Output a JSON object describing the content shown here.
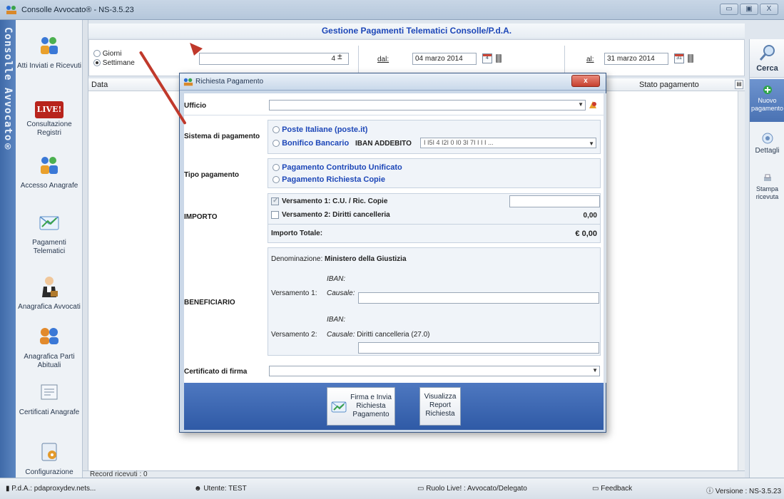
{
  "window": {
    "title": "Consolle Avvocato® - NS-3.5.23",
    "buttons": [
      "▭",
      "▣",
      "X"
    ]
  },
  "left_strip": {
    "text": "Consolle Avvocato®"
  },
  "nav": [
    {
      "label": "Atti Inviati e Ricevuti",
      "icon": "people-icon"
    },
    {
      "label": "Consultazione Registri",
      "icon": "live-icon",
      "badge": "LIVE!"
    },
    {
      "label": "Accesso Anagrafe",
      "icon": "people-icon"
    },
    {
      "label": "Pagamenti Telematici",
      "icon": "envelope-icon"
    },
    {
      "label": "Anagrafica Avvocati",
      "icon": "lawyer-icon"
    },
    {
      "label": "Anagrafica Parti Abituali",
      "icon": "people-pair-icon"
    },
    {
      "label": "Certificati Anagrafe",
      "icon": "certificate-icon"
    },
    {
      "label": "Configurazione",
      "icon": "config-icon"
    }
  ],
  "header": {
    "title": "Gestione Pagamenti Telematici Consolle/P.d.A."
  },
  "filter": {
    "radio_giorni": "Giorni",
    "radio_settimane": "Settimane",
    "number_value": "4",
    "dal_label": "dal:",
    "dal_value": "04 marzo 2014",
    "al_label": "al:",
    "al_value": "31 marzo 2014",
    "cal1": "4",
    "cal2": "31"
  },
  "table": {
    "col_data": "Data",
    "col_stato": "Stato pagamento",
    "record_count": "Record ricevuti : 0"
  },
  "right_bar": {
    "cerca": "Cerca",
    "nuovo": "Nuovo pagamento",
    "dettagli": "Dettagli",
    "stampa": "Stampa ricevuta"
  },
  "status": {
    "pda": "P.d.A.: pdaproxydev.nets...",
    "utente": "Utente: TEST",
    "ruolo": "Ruolo Live! : Avvocato/Delegato",
    "feedback": "Feedback",
    "versione": "Versione : NS-3.5.23"
  },
  "dialog": {
    "title": "Richiesta Pagamento",
    "close": "x",
    "ufficio_label": "Ufficio",
    "sistema_label": "Sistema di pagamento",
    "sistema_opt1": "Poste Italiane (poste.it)",
    "sistema_opt2": "Bonifico Bancario",
    "iban_addebito_label": "IBAN ADDEBITO",
    "iban_addebito_value": "I  I5I   4  I2I   0  I0   3I  7I  I  I  I ...",
    "tipo_label": "Tipo pagamento",
    "tipo_opt1": "Pagamento Contributo Unificato",
    "tipo_opt2": "Pagamento Richiesta Copie",
    "importo_label": "IMPORTO",
    "versamento1": "Versamento 1:  C.U. / Ric. Copie",
    "versamento2": "Versamento 2:  Diritti cancelleria",
    "versamento2_value": "0,00",
    "importo_totale_label": "Importo Totale:",
    "importo_totale_value": "€ 0,00",
    "beneficiario_label": "BENEFICIARIO",
    "denominazione_label": "Denominazione:",
    "denominazione_value": "Ministero della Giustizia",
    "iban_label": "IBAN:",
    "causale_label": "Causale:",
    "vers1_label": "Versamento 1:",
    "vers2_label": "Versamento 2:",
    "vers2_causale": "Diritti cancelleria (27.0)",
    "certificato_label": "Certificato di firma",
    "btn_firma": "Firma e Invia Richiesta Pagamento",
    "btn_visualizza": "Visualizza Report Richiesta"
  }
}
